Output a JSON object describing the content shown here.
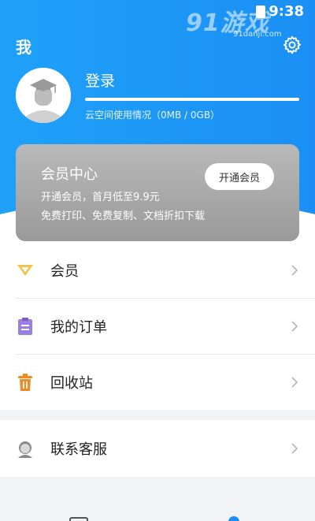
{
  "status_bar": {
    "time": "9:38"
  },
  "watermark": {
    "logo": "91游戏",
    "site": "91danji.com"
  },
  "header": {
    "title": "我"
  },
  "profile": {
    "login_label": "登录",
    "storage_text": "云空间使用情况（0MB / 0GB）",
    "storage_used_fraction": 0.0
  },
  "vip_card": {
    "title": "会员中心",
    "line1": "开通会员，首月低至9.9元",
    "line2": "免费打印、免费复制、文档折扣下载",
    "button": "开通会员"
  },
  "menu": {
    "items": [
      {
        "label": "会员",
        "icon": "vip-diamond-icon"
      },
      {
        "label": "我的订单",
        "icon": "order-clipboard-icon"
      },
      {
        "label": "回收站",
        "icon": "trash-icon"
      }
    ]
  },
  "support": {
    "label": "联系客服",
    "icon": "customer-service-icon"
  },
  "colors": {
    "header_blue": "#1b8ff5",
    "vip_gold": "#f2c14e",
    "order_purple": "#9b7fe0",
    "trash_orange": "#f08a24"
  }
}
